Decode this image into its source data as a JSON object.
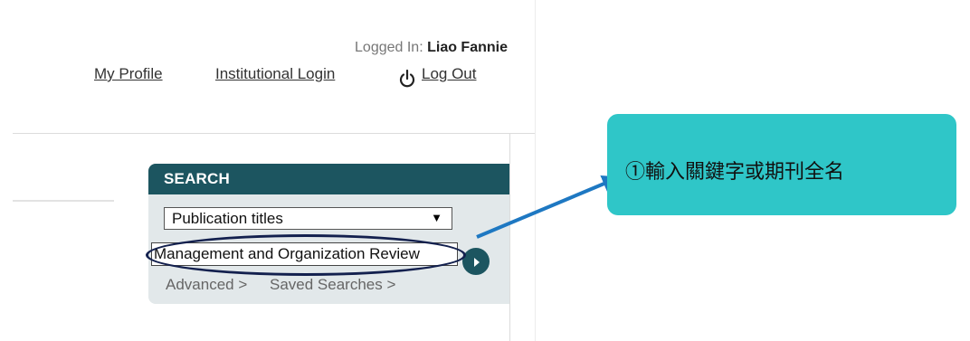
{
  "header": {
    "logged_in_label": "Logged In:",
    "user_name": "Liao Fannie",
    "links": {
      "my_profile": "My Profile",
      "institutional_login": "Institutional Login",
      "log_out": "Log Out"
    },
    "icons": {
      "log_out": "power-icon"
    }
  },
  "search": {
    "title": "SEARCH",
    "scope": {
      "selected": "Publication titles"
    },
    "query": {
      "value": "Management and Organization Review"
    },
    "links": {
      "advanced": "Advanced >",
      "saved_searches": "Saved Searches >"
    },
    "icons": {
      "submit": "play-icon",
      "scope_dropdown": "chevron-down-icon"
    }
  },
  "annotation": {
    "callout_text": "①輸入關鍵字或期刊全名"
  },
  "colors": {
    "search_header": "#1c5560",
    "search_panel": "#e2e8ea",
    "callout": "#2fc6c8",
    "arrow": "#1e78c2",
    "ellipse": "#13204e"
  }
}
